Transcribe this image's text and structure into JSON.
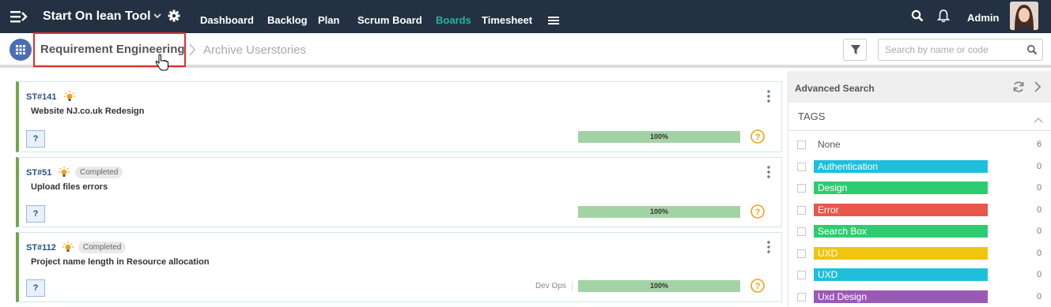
{
  "topbar": {
    "app_title": "Start On lean Tool",
    "nav": [
      {
        "label": "Dashboard",
        "active": false
      },
      {
        "label": "Backlog",
        "active": false
      },
      {
        "label": "Plan",
        "active": false
      },
      {
        "label": "Scrum Board",
        "active": false
      },
      {
        "label": "Boards",
        "active": true
      },
      {
        "label": "Timesheet",
        "active": false
      }
    ],
    "user_name": "Admin",
    "accent_color": "#22b49f",
    "bg_color": "#243142"
  },
  "breadcrumb": {
    "current": "Requirement Engineering",
    "next": "Archive Userstories"
  },
  "search": {
    "placeholder": "Search by name or code"
  },
  "stories": [
    {
      "code": "ST#141",
      "title": "Website NJ.co.uk Redesign",
      "badge": "",
      "progress_label": "100%",
      "progress": 1.0,
      "tag": "",
      "action_label": "?"
    },
    {
      "code": "ST#51",
      "title": "Upload files errors",
      "badge": "Completed",
      "progress_label": "100%",
      "progress": 1.0,
      "tag": "",
      "action_label": "?"
    },
    {
      "code": "ST#112",
      "title": "Project name length in Resource allocation",
      "badge": "Completed",
      "progress_label": "100%",
      "progress": 1.0,
      "tag": "Dev Ops",
      "action_label": "?"
    }
  ],
  "sidebar": {
    "title": "Advanced Search",
    "tags_title": "TAGS",
    "tags": [
      {
        "label": "None",
        "count": "6",
        "color": ""
      },
      {
        "label": "Authentication",
        "count": "0",
        "color": "#1fbfdc"
      },
      {
        "label": "Design",
        "count": "0",
        "color": "#2ecc71"
      },
      {
        "label": "Error",
        "count": "0",
        "color": "#e8574a"
      },
      {
        "label": "Search Box",
        "count": "0",
        "color": "#2ecc71"
      },
      {
        "label": "UXD",
        "count": "0",
        "color": "#f1c40f"
      },
      {
        "label": "UXD",
        "count": "0",
        "color": "#1fbfdc"
      },
      {
        "label": "Uxd Design",
        "count": "0",
        "color": "#9b59b6"
      }
    ]
  }
}
